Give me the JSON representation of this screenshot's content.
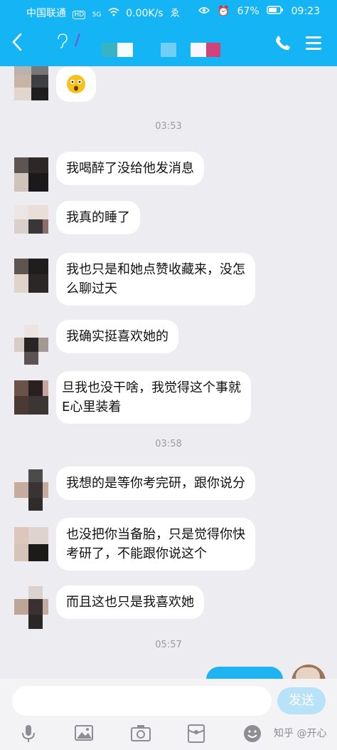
{
  "status_bar": {
    "carrier": "中国联通",
    "net_badge": "HD",
    "signal": "5G",
    "speed": "0.00K/s",
    "battery_pct": "67%",
    "time": "09:23"
  },
  "header": {
    "back_glyph": "‹"
  },
  "timestamps": [
    "03:53",
    "03:58",
    "05:57"
  ],
  "messages": [
    {
      "text": "我喝醉了没给他发消息"
    },
    {
      "text": "我真的睡了"
    },
    {
      "line1": "我也只是和她点赞收藏来，没怎",
      "line2": "么聊过天"
    },
    {
      "text": "我确实挺喜欢她的"
    },
    {
      "line1": "旦我也没干啥，我觉得这个事就",
      "line2": "E心里装着"
    },
    {
      "text": "我想的是等你考完研，跟你说分"
    },
    {
      "line1": "也没把你当备胎，只是觉得你快",
      "line2": "考研了，不能跟你说这个"
    },
    {
      "text": "而且这也只是我喜欢她"
    }
  ],
  "input": {
    "placeholder": "",
    "send_label": "发送"
  },
  "watermark": "知乎 @开心",
  "colors": {
    "header_blue": "#15b4f4",
    "chat_bg": "#ececf1",
    "send_disabled": "#b8e2f8"
  }
}
